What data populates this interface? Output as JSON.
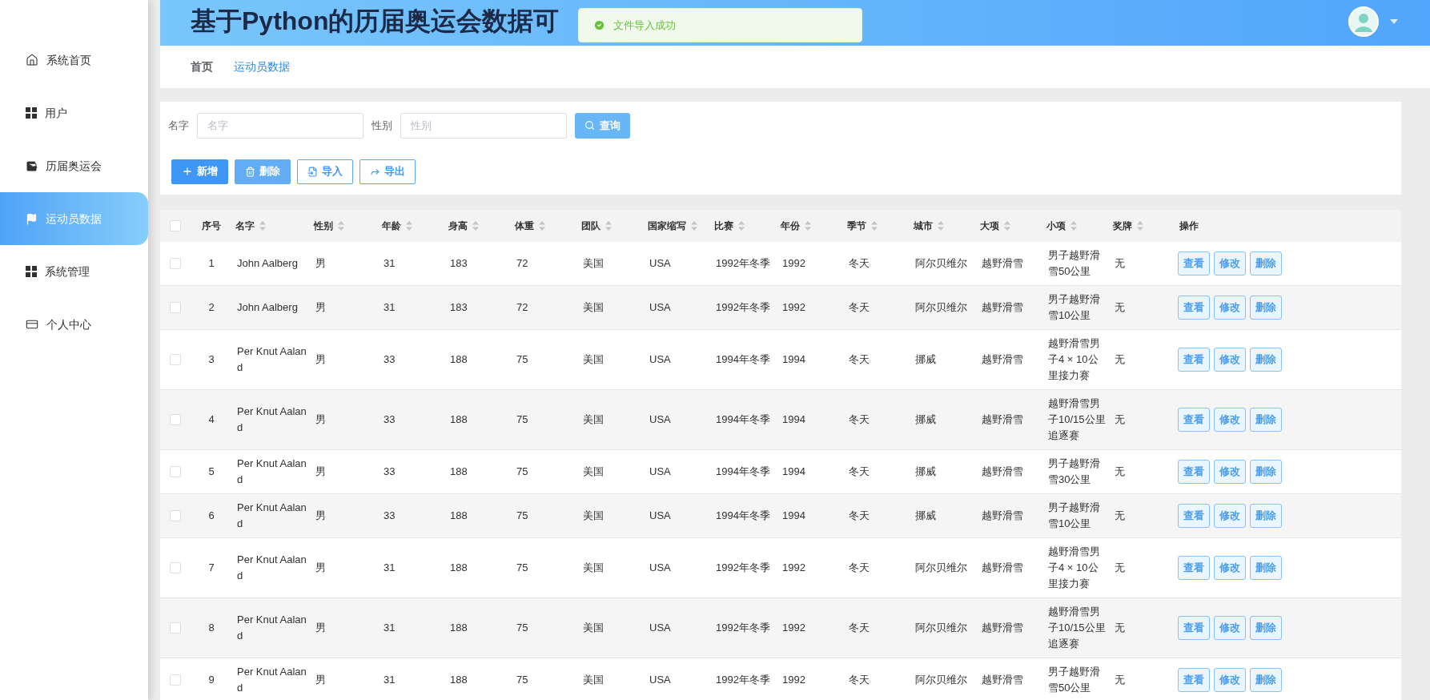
{
  "sidebar": {
    "items": [
      {
        "label": "系统首页",
        "selected": false
      },
      {
        "label": "用户",
        "selected": false
      },
      {
        "label": "历届奥运会",
        "selected": false
      },
      {
        "label": "运动员数据",
        "selected": true
      },
      {
        "label": "系统管理",
        "selected": false
      },
      {
        "label": "个人中心",
        "selected": false
      }
    ]
  },
  "header": {
    "title": "基于Python的历届奥运会数据可"
  },
  "toast": {
    "kind": "success",
    "message": "文件导入成功"
  },
  "breadcrumb": [
    {
      "label": "首页",
      "current": false
    },
    {
      "label": "运动员数据",
      "current": true
    }
  ],
  "search": {
    "fields": [
      {
        "label": "名字",
        "placeholder": "名字"
      },
      {
        "label": "性别",
        "placeholder": "性别"
      }
    ],
    "button": "查询"
  },
  "actions": [
    {
      "label": "新增",
      "kind": "filled",
      "disabled": false
    },
    {
      "label": "删除",
      "kind": "filled",
      "disabled": true
    },
    {
      "label": "导入",
      "kind": "outline",
      "disabled": false
    },
    {
      "label": "导出",
      "kind": "outline",
      "disabled": false
    }
  ],
  "table": {
    "all_checked": false,
    "columns": [
      {
        "label": "序号",
        "sortable": false
      },
      {
        "label": "名字",
        "sortable": true
      },
      {
        "label": "性别",
        "sortable": true
      },
      {
        "label": "年龄",
        "sortable": true
      },
      {
        "label": "身高",
        "sortable": true
      },
      {
        "label": "体重",
        "sortable": true
      },
      {
        "label": "团队",
        "sortable": true
      },
      {
        "label": "国家缩写",
        "sortable": true
      },
      {
        "label": "比赛",
        "sortable": true
      },
      {
        "label": "年份",
        "sortable": true
      },
      {
        "label": "季节",
        "sortable": true
      },
      {
        "label": "城市",
        "sortable": true
      },
      {
        "label": "大项",
        "sortable": true
      },
      {
        "label": "小项",
        "sortable": true
      },
      {
        "label": "奖牌",
        "sortable": true
      },
      {
        "label": "操作",
        "sortable": false
      }
    ],
    "rows": [
      {
        "checked": false,
        "cells": [
          "1",
          "John Aalberg",
          "男",
          "31",
          "183",
          "72",
          "美国",
          "USA",
          "1992年冬季",
          "1992",
          "冬天",
          "阿尔贝维尔",
          "越野滑雪",
          "男子越野滑雪50公里",
          "无"
        ],
        "actions": [
          "查看",
          "修改",
          "删除"
        ]
      },
      {
        "checked": false,
        "cells": [
          "2",
          "John Aalberg",
          "男",
          "31",
          "183",
          "72",
          "美国",
          "USA",
          "1992年冬季",
          "1992",
          "冬天",
          "阿尔贝维尔",
          "越野滑雪",
          "男子越野滑雪10公里",
          "无"
        ],
        "actions": [
          "查看",
          "修改",
          "删除"
        ]
      },
      {
        "checked": false,
        "cells": [
          "3",
          "Per Knut Aaland",
          "男",
          "33",
          "188",
          "75",
          "美国",
          "USA",
          "1994年冬季",
          "1994",
          "冬天",
          "挪威",
          "越野滑雪",
          "越野滑雪男子4 × 10公里接力赛",
          "无"
        ],
        "actions": [
          "查看",
          "修改",
          "删除"
        ]
      },
      {
        "checked": false,
        "cells": [
          "4",
          "Per Knut Aaland",
          "男",
          "33",
          "188",
          "75",
          "美国",
          "USA",
          "1994年冬季",
          "1994",
          "冬天",
          "挪威",
          "越野滑雪",
          "越野滑雪男子10/15公里追逐赛",
          "无"
        ],
        "actions": [
          "查看",
          "修改",
          "删除"
        ]
      },
      {
        "checked": false,
        "cells": [
          "5",
          "Per Knut Aaland",
          "男",
          "33",
          "188",
          "75",
          "美国",
          "USA",
          "1994年冬季",
          "1994",
          "冬天",
          "挪威",
          "越野滑雪",
          "男子越野滑雪30公里",
          "无"
        ],
        "actions": [
          "查看",
          "修改",
          "删除"
        ]
      },
      {
        "checked": false,
        "cells": [
          "6",
          "Per Knut Aaland",
          "男",
          "33",
          "188",
          "75",
          "美国",
          "USA",
          "1994年冬季",
          "1994",
          "冬天",
          "挪威",
          "越野滑雪",
          "男子越野滑雪10公里",
          "无"
        ],
        "actions": [
          "查看",
          "修改",
          "删除"
        ]
      },
      {
        "checked": false,
        "cells": [
          "7",
          "Per Knut Aaland",
          "男",
          "31",
          "188",
          "75",
          "美国",
          "USA",
          "1992年冬季",
          "1992",
          "冬天",
          "阿尔贝维尔",
          "越野滑雪",
          "越野滑雪男子4 × 10公里接力赛",
          "无"
        ],
        "actions": [
          "查看",
          "修改",
          "删除"
        ]
      },
      {
        "checked": false,
        "cells": [
          "8",
          "Per Knut Aaland",
          "男",
          "31",
          "188",
          "75",
          "美国",
          "USA",
          "1992年冬季",
          "1992",
          "冬天",
          "阿尔贝维尔",
          "越野滑雪",
          "越野滑雪男子10/15公里追逐赛",
          "无"
        ],
        "actions": [
          "查看",
          "修改",
          "删除"
        ]
      },
      {
        "checked": false,
        "cells": [
          "9",
          "Per Knut Aaland",
          "男",
          "31",
          "188",
          "75",
          "美国",
          "USA",
          "1992年冬季",
          "1992",
          "冬天",
          "阿尔贝维尔",
          "越野滑雪",
          "男子越野滑雪50公里",
          "无"
        ],
        "actions": [
          "查看",
          "修改",
          "删除"
        ]
      }
    ]
  }
}
